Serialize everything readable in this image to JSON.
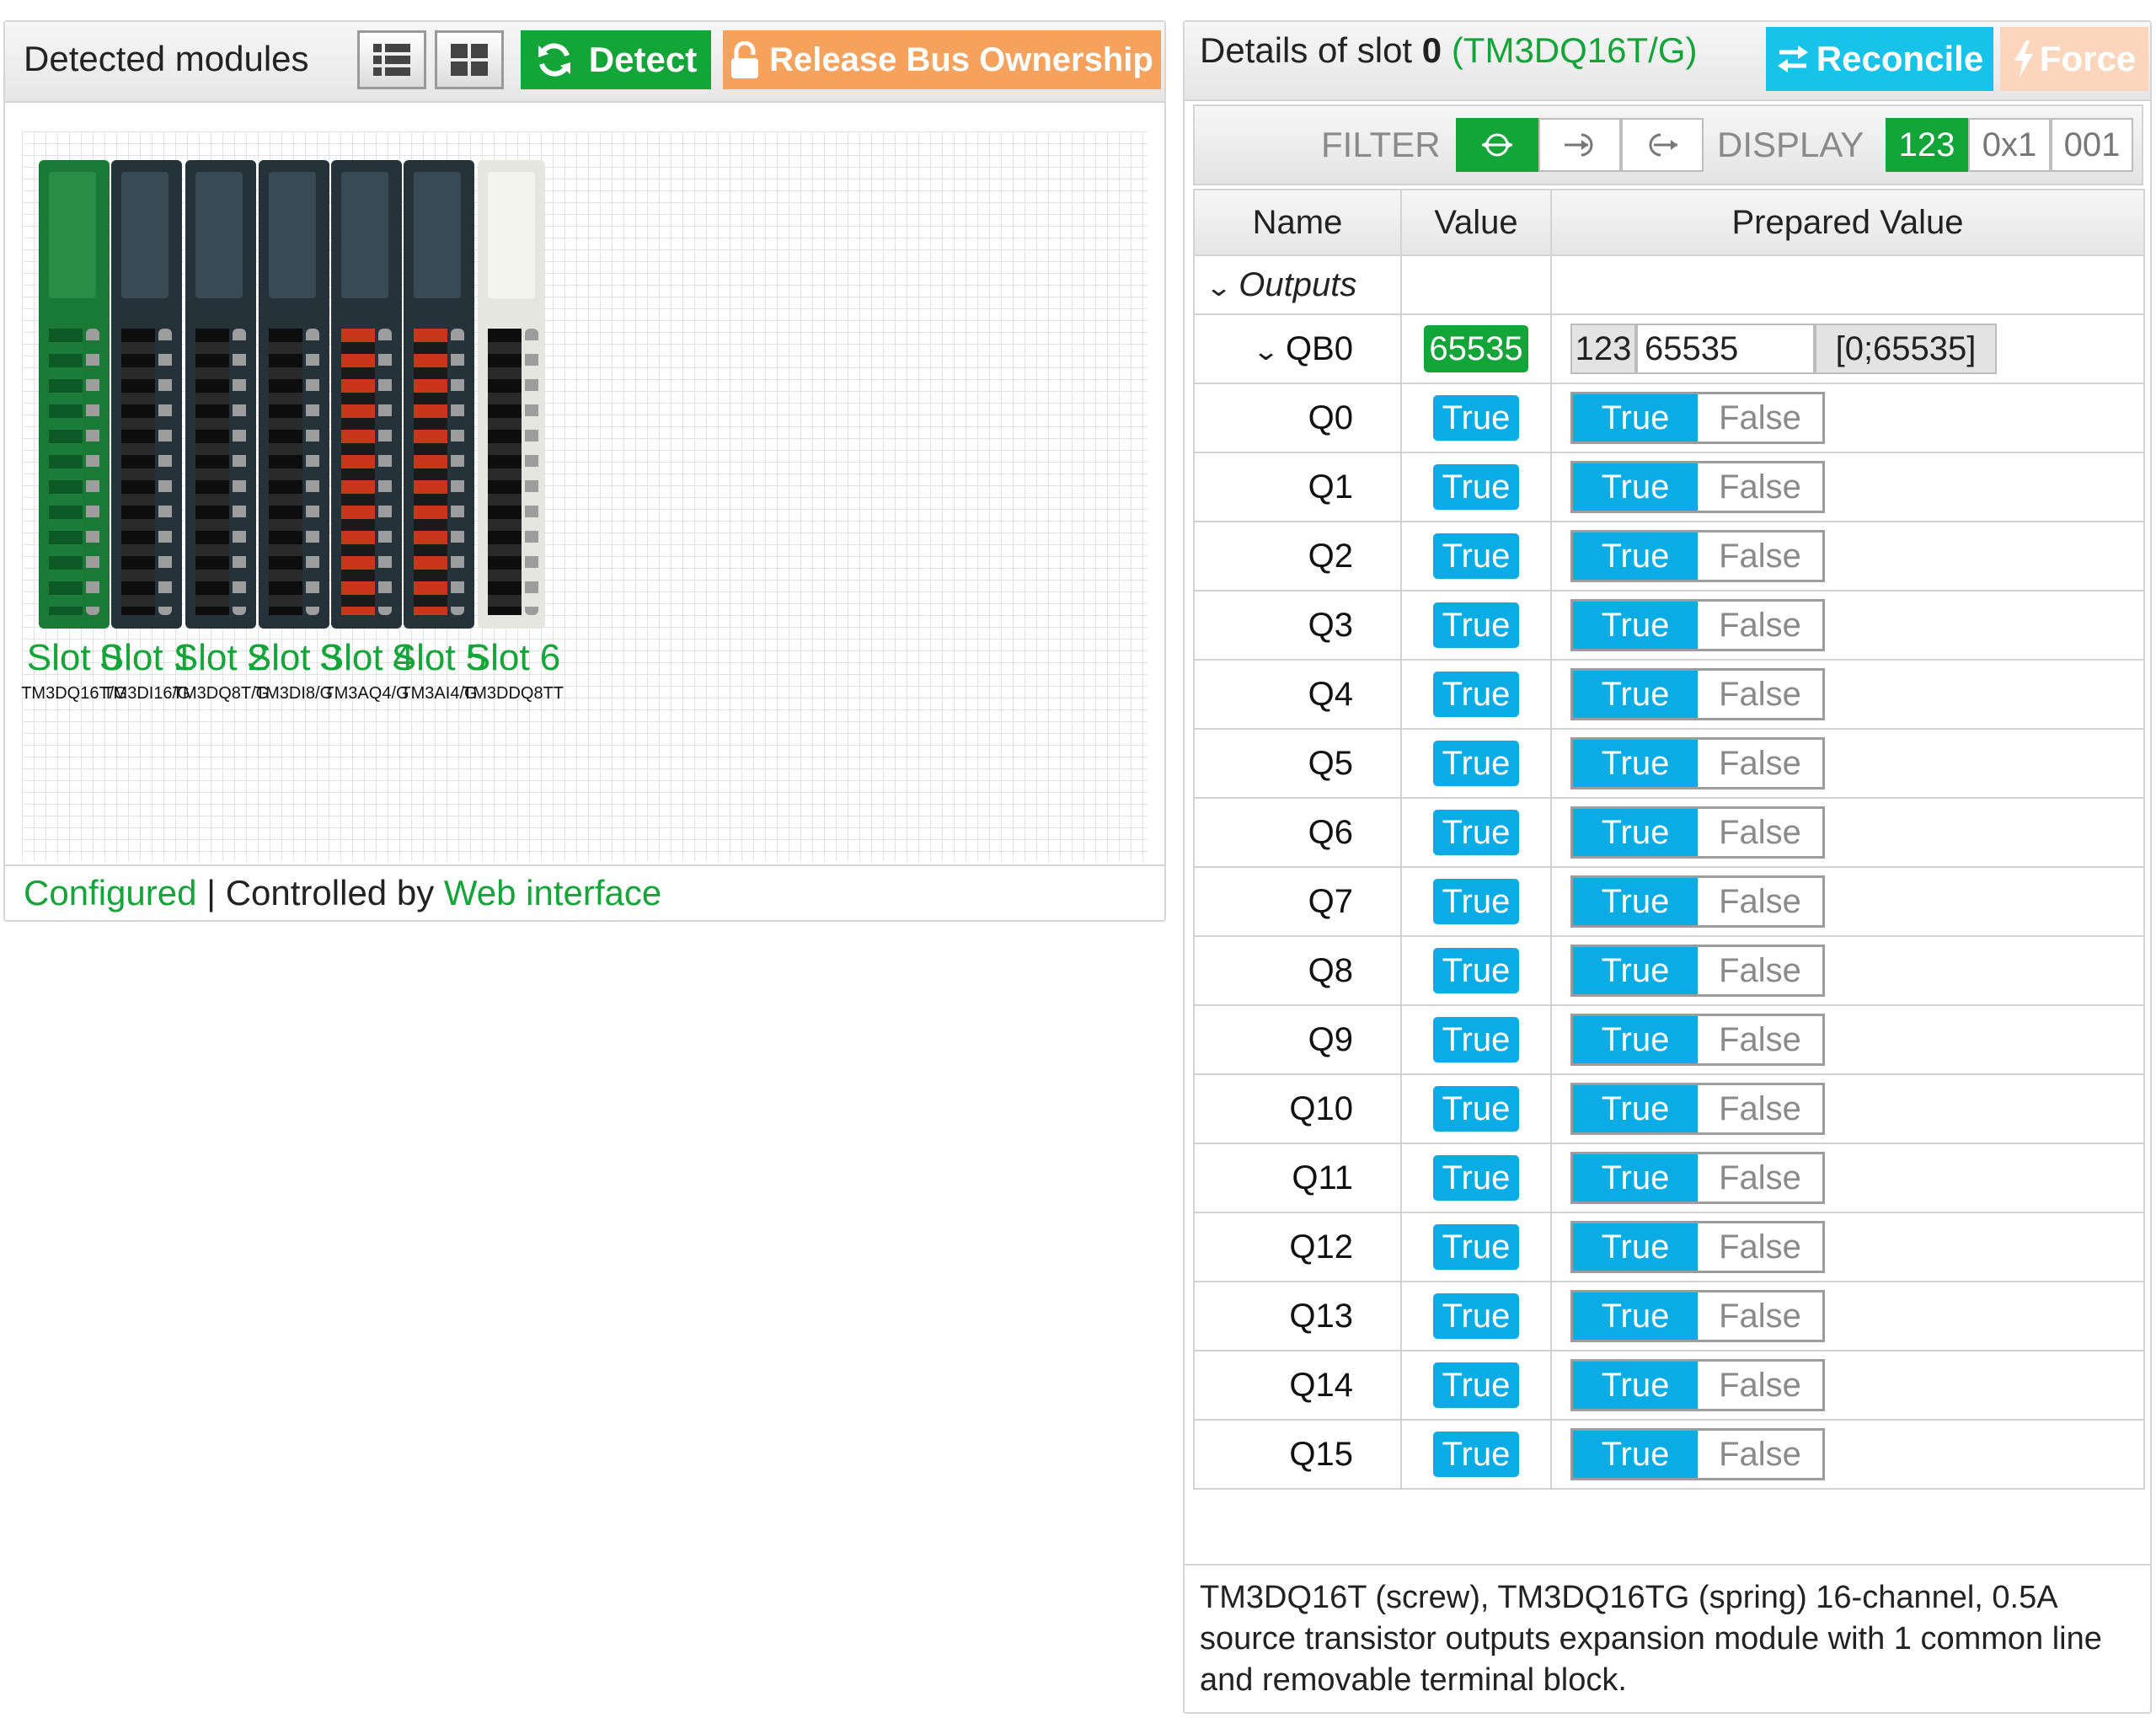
{
  "left": {
    "title": "Detected modules",
    "detect_label": "Detect",
    "release_label": "Release Bus Ownership",
    "status_configured": "Configured",
    "status_separator": "| Controlled by",
    "status_controller": "Web interface",
    "slots": [
      {
        "label": "Slot 0",
        "ref": "TM3DQ16T/G",
        "color": "#1a7a35"
      },
      {
        "label": "Slot 1",
        "ref": "TM3DI16/G",
        "color": "#26323a"
      },
      {
        "label": "Slot 2",
        "ref": "TM3DQ8T/G",
        "color": "#26323a"
      },
      {
        "label": "Slot 3",
        "ref": "TM3DI8/G",
        "color": "#26323a"
      },
      {
        "label": "Slot 4",
        "ref": "TM3AQ4/G",
        "color": "#26323a"
      },
      {
        "label": "Slot 5",
        "ref": "TM3AI4/G",
        "color": "#26323a"
      },
      {
        "label": "Slot 6",
        "ref": "TM3DDQ8TT",
        "color": "#e6e6e0"
      }
    ]
  },
  "right": {
    "title_prefix": "Details of slot",
    "slot_number": "0",
    "slot_module": "(TM3DQ16T/G)",
    "reconcile_label": "Reconcile",
    "force_label": "Force",
    "filter_label": "FILTER",
    "display_label": "DISPLAY",
    "display_options": [
      "123",
      "0x1",
      "001"
    ],
    "columns": [
      "Name",
      "Value",
      "Prepared Value"
    ],
    "group": "Outputs",
    "byte": {
      "name": "QB0",
      "value": "65535",
      "format": "123",
      "prepared": "65535",
      "range": "[0;65535]"
    },
    "bits": [
      {
        "name": "Q0",
        "value": "True"
      },
      {
        "name": "Q1",
        "value": "True"
      },
      {
        "name": "Q2",
        "value": "True"
      },
      {
        "name": "Q3",
        "value": "True"
      },
      {
        "name": "Q4",
        "value": "True"
      },
      {
        "name": "Q5",
        "value": "True"
      },
      {
        "name": "Q6",
        "value": "True"
      },
      {
        "name": "Q7",
        "value": "True"
      },
      {
        "name": "Q8",
        "value": "True"
      },
      {
        "name": "Q9",
        "value": "True"
      },
      {
        "name": "Q10",
        "value": "True"
      },
      {
        "name": "Q11",
        "value": "True"
      },
      {
        "name": "Q12",
        "value": "True"
      },
      {
        "name": "Q13",
        "value": "True"
      },
      {
        "name": "Q14",
        "value": "True"
      },
      {
        "name": "Q15",
        "value": "True"
      }
    ],
    "toggle_true": "True",
    "toggle_false": "False",
    "description": "TM3DQ16T (screw), TM3DQ16TG (spring) 16-channel, 0.5A source transistor outputs expansion module with 1 common line and removable terminal block."
  },
  "icons": {
    "list": "list-view-icon",
    "grid": "grid-view-icon",
    "detect": "refresh-icon",
    "release": "lock-open-icon",
    "reconcile": "swap-arrows-icon",
    "force": "lightning-icon"
  },
  "colors": {
    "accent_green": "#13a538",
    "accent_blue": "#0aace6",
    "release_orange": "#f6a15c",
    "force_peach": "#fbd6bd"
  }
}
